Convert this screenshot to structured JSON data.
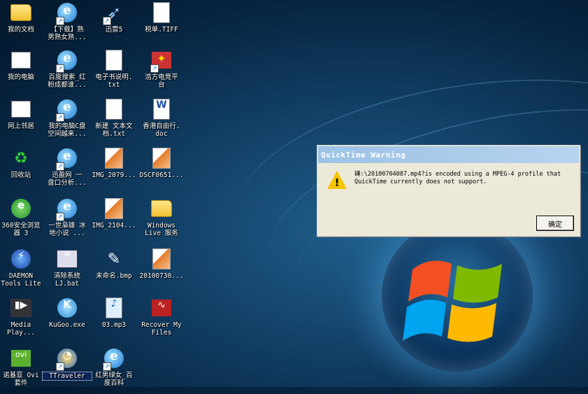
{
  "desktop": {
    "icons": [
      {
        "label": "我的文档",
        "icon": "folder-icon"
      },
      {
        "label": "【下载】熟\n男熟女熟...",
        "icon": "ie-shortcut-icon"
      },
      {
        "label": "迅雷5",
        "icon": "thunder-icon"
      },
      {
        "label": "税单.TIFF",
        "icon": "image-file-icon"
      },
      {
        "label": "我的电脑",
        "icon": "computer-icon"
      },
      {
        "label": "百度搜索_红\n粉成都谁...",
        "icon": "ie-shortcut-icon"
      },
      {
        "label": "电子书说明.\ntxt",
        "icon": "text-file-icon"
      },
      {
        "label": "浩方电竞平\n台",
        "icon": "game-platform-icon"
      },
      {
        "label": "网上邻居",
        "icon": "network-icon"
      },
      {
        "label": "我的电脑C盘\n空间越来...",
        "icon": "ie-shortcut-icon"
      },
      {
        "label": "新建 文本文\n档.txt",
        "icon": "text-file-icon"
      },
      {
        "label": "香港自由行.\ndoc",
        "icon": "word-doc-icon"
      },
      {
        "label": "回收站",
        "icon": "recycle-bin-icon"
      },
      {
        "label": "迅盈网 一\n盘口分析...",
        "icon": "ie-shortcut-icon"
      },
      {
        "label": "IMG_2079...",
        "icon": "image-file-icon"
      },
      {
        "label": "DSCF0651...",
        "icon": "image-file-icon"
      },
      {
        "label": "360安全浏览\n器 3",
        "icon": "browser-360-icon"
      },
      {
        "label": "一世枭雄 冰\n地小说 ...",
        "icon": "ie-shortcut-icon"
      },
      {
        "label": "IMG_2104...",
        "icon": "image-file-icon"
      },
      {
        "label": "Windows\nLive 服务",
        "icon": "folder-icon"
      },
      {
        "label": "DAEMON\nTools Lite",
        "icon": "daemon-tools-icon"
      },
      {
        "label": "清除系统\nLJ.bat",
        "icon": "batch-file-icon"
      },
      {
        "label": "未命名.bmp",
        "icon": "bitmap-file-icon"
      },
      {
        "label": "20100730...",
        "icon": "image-file-icon"
      },
      {
        "label": "Media\nPlay...",
        "icon": "media-player-icon"
      },
      {
        "label": "KuGoo.exe",
        "icon": "kugoo-icon"
      },
      {
        "label": "03.mp3",
        "icon": "mp3-file-icon"
      },
      {
        "label": "Recover My\nFiles",
        "icon": "recover-files-icon"
      },
      {
        "label": "诺基亚 Ovi\n套件",
        "icon": "ovi-icon"
      },
      {
        "label": "TTraveler",
        "icon": "ttraveler-icon"
      },
      {
        "label": "红男绿女_百\n度百科",
        "icon": "ie-shortcut-icon"
      }
    ]
  },
  "dialog": {
    "title": "QuickTime Warning",
    "message": "磚:\\20100704087.mp4?is encoded using a MPEG-4 profile that QuickTime currently does not support.",
    "ok_label": "确定",
    "icon": "warning-icon"
  },
  "colors": {
    "titlebar": "#9cc2e5",
    "dialog_bg": "#ece9d8",
    "warning": "#f5c400"
  }
}
